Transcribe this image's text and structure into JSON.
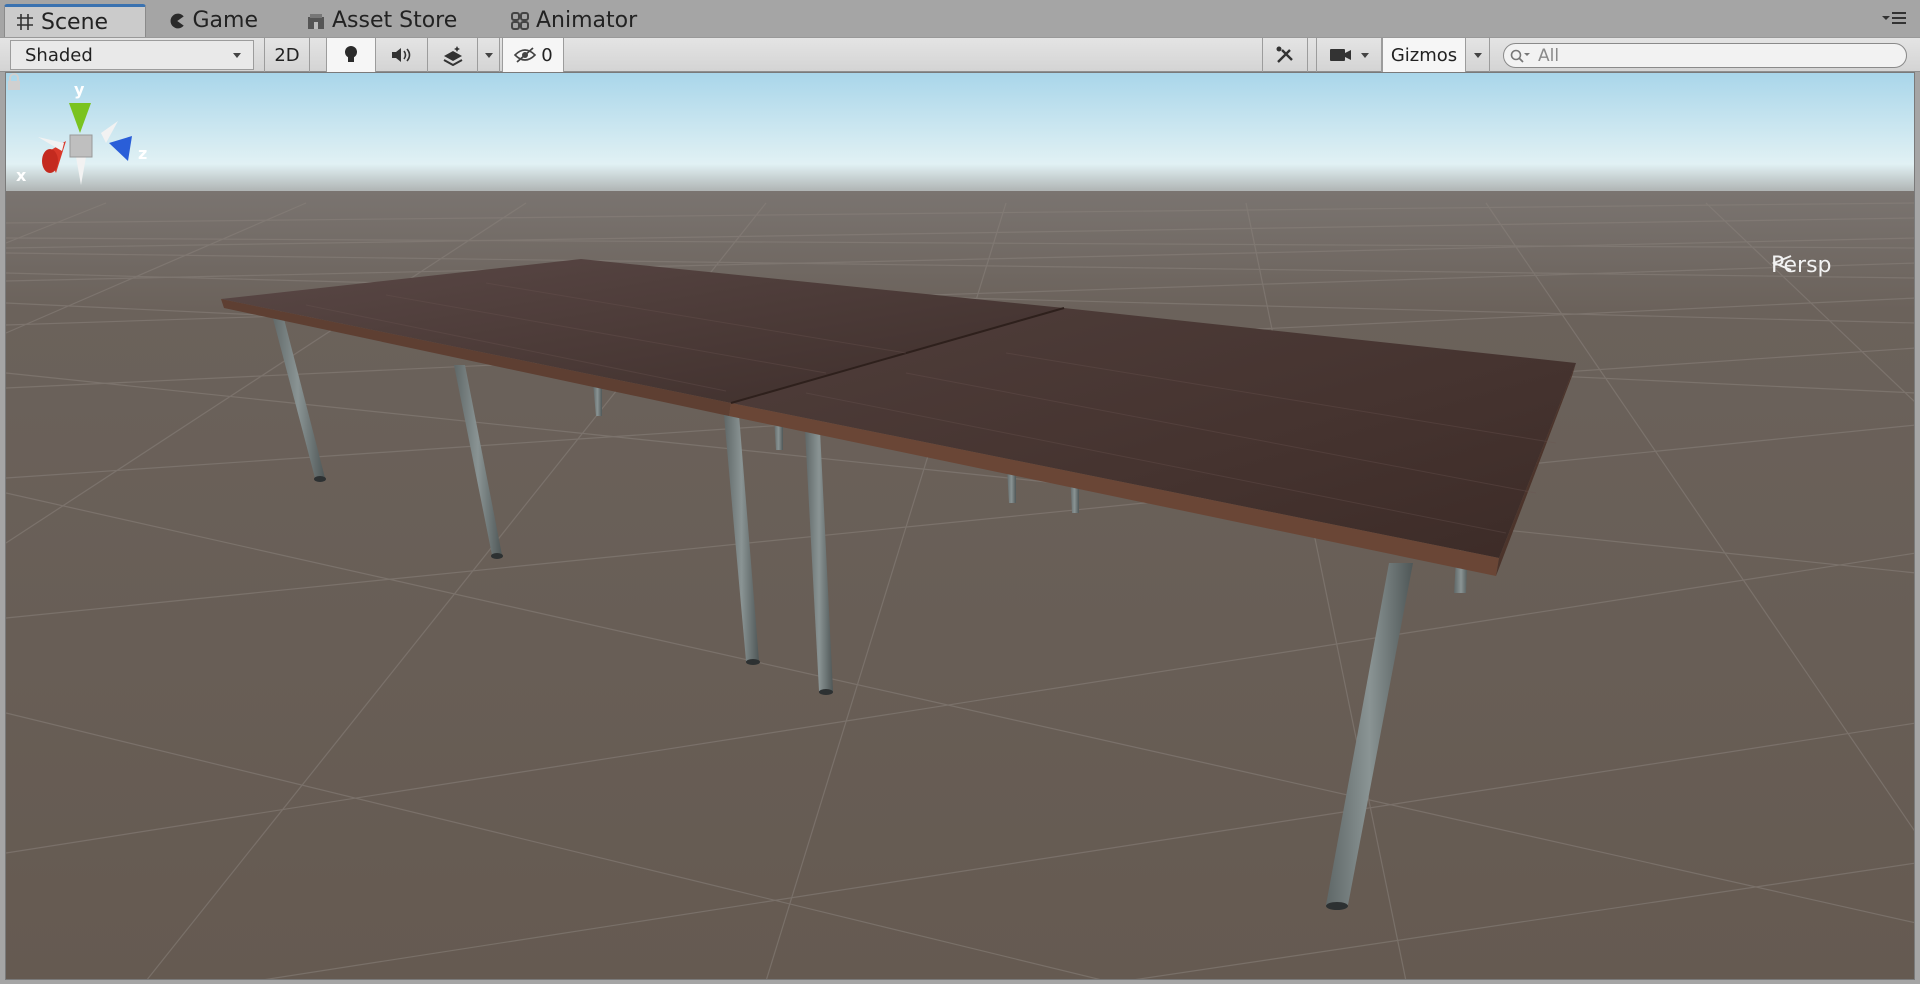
{
  "tabs": [
    {
      "label": "Scene",
      "icon": "grid-icon",
      "active": true
    },
    {
      "label": "Game",
      "icon": "pacman-icon",
      "active": false
    },
    {
      "label": "Asset Store",
      "icon": "store-icon",
      "active": false
    },
    {
      "label": "Animator",
      "icon": "animator-icon",
      "active": false
    }
  ],
  "toolbar": {
    "shading_mode": "Shaded",
    "mode_2d_label": "2D",
    "hidden_count": "0",
    "gizmos_label": "Gizmos",
    "search_placeholder": "All"
  },
  "viewport": {
    "projection_label": "Persp",
    "axis_labels": {
      "x": "x",
      "y": "y",
      "z": "z"
    }
  },
  "colors": {
    "tab_accent": "#3a72b0",
    "axis_x": "#d9382a",
    "axis_y": "#7ac31f",
    "axis_z": "#2a5ed8",
    "ground": "#6a6058",
    "sky": "#d6eef6"
  }
}
